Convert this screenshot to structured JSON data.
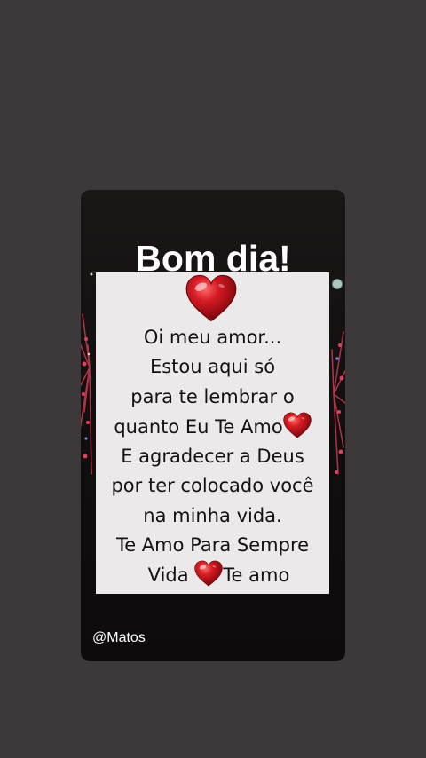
{
  "greeting": "Bom dia!",
  "message_lines": [
    "Oi meu amor...",
    "Estou aqui só",
    "para te lembrar o",
    "quanto Eu Te Amo",
    "E agradecer a Deus",
    "por ter colocado você",
    "na minha vida.",
    "Te Amo Para Sempre"
  ],
  "last_line": {
    "before_heart": "Vida",
    "after_heart": "Te amo"
  },
  "watermark": "@Matos",
  "icons": {
    "note_top": "heart-icon",
    "inline": "heart-icon"
  },
  "colors": {
    "page_background": "#3d393b",
    "card_background": "#141112",
    "note_background": "#ece9ea",
    "heart_red": "#c8161f",
    "text_dark": "#161212"
  }
}
